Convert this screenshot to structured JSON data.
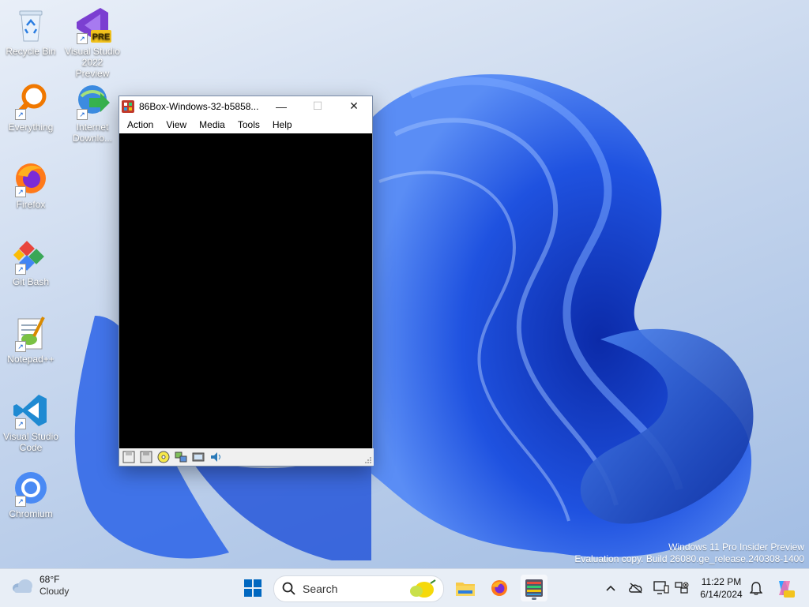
{
  "desktop": {
    "icons": [
      {
        "label": "Recycle Bin",
        "icon": "recycle-bin-icon"
      },
      {
        "label": "Visual Studio 2022 Preview",
        "icon": "visual-studio-icon",
        "badge": "PRE"
      },
      {
        "label": "Everything",
        "icon": "search-lens-icon"
      },
      {
        "label": "Internet Downlo...",
        "icon": "idm-icon"
      },
      {
        "label": "Firefox",
        "icon": "firefox-icon"
      },
      {
        "label": "Git Bash",
        "icon": "git-icon"
      },
      {
        "label": "Notepad++",
        "icon": "notepadpp-icon"
      },
      {
        "label": "Visual Studio Code",
        "icon": "vscode-icon"
      },
      {
        "label": "Chromium",
        "icon": "chromium-icon"
      }
    ]
  },
  "window": {
    "title": "86Box-Windows-32-b5858...",
    "menu": [
      "Action",
      "View",
      "Media",
      "Tools",
      "Help"
    ],
    "minimize_glyph": "—",
    "maximize_glyph": "☐",
    "close_glyph": "✕"
  },
  "watermark": {
    "line1": "Windows 11 Pro Insider Preview",
    "line2": "Evaluation copy. Build 26080.ge_release.240308-1400"
  },
  "taskbar": {
    "weather_temp": "68°F",
    "weather_cond": "Cloudy",
    "search_label": "Search",
    "time": "11:22 PM",
    "date": "6/14/2024"
  },
  "colors": {
    "accent": "#0067c0",
    "bloom_dark": "#0a2fb5",
    "bloom_light": "#2f6df0"
  }
}
